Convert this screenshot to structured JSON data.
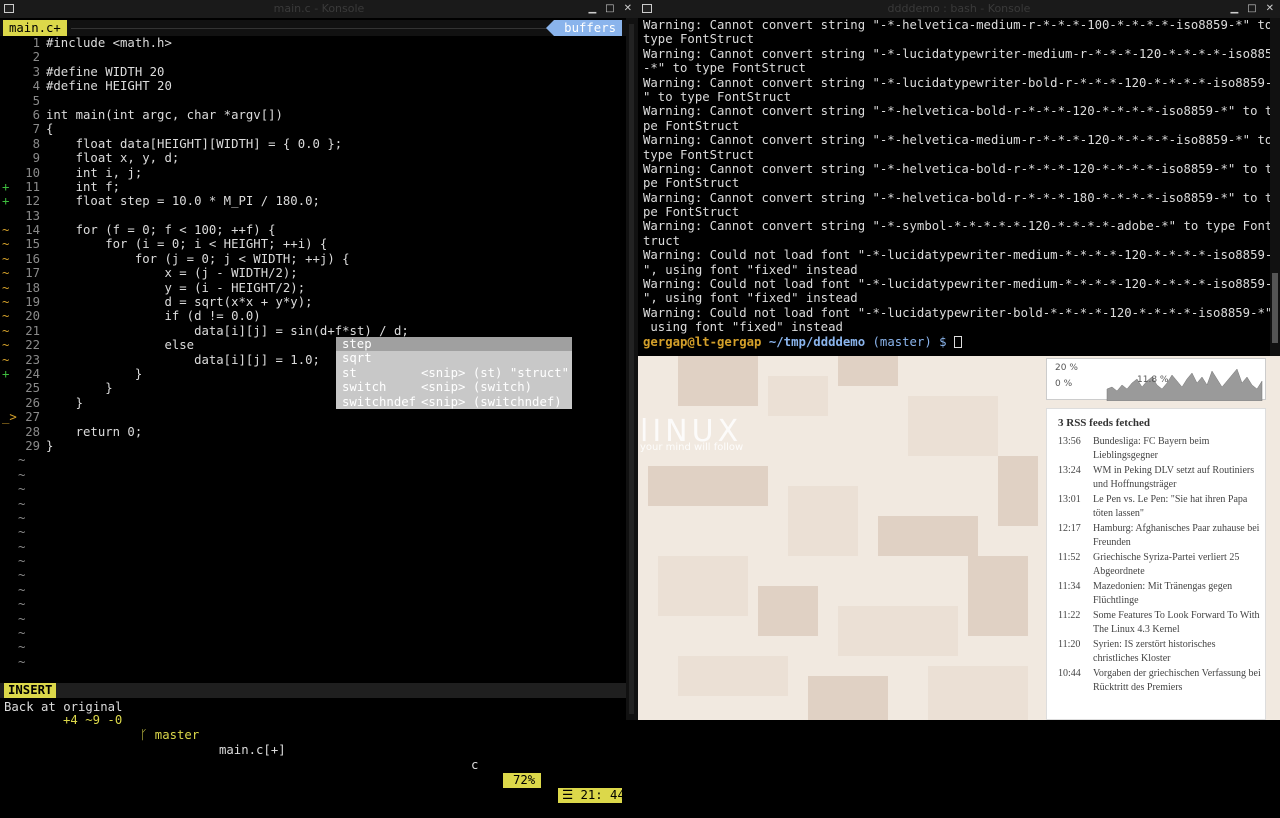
{
  "left_window": {
    "title": "main.c - Konsole"
  },
  "right_window": {
    "title": "ddddemo : bash - Konsole"
  },
  "vim": {
    "tab": "main.c+",
    "buffers_label": "buffers",
    "lines": [
      {
        "sign": "",
        "num": "1",
        "code": "#include <math.h>"
      },
      {
        "sign": "",
        "num": "2",
        "code": ""
      },
      {
        "sign": "",
        "num": "3",
        "code": "#define WIDTH 20"
      },
      {
        "sign": "",
        "num": "4",
        "code": "#define HEIGHT 20"
      },
      {
        "sign": "",
        "num": "5",
        "code": ""
      },
      {
        "sign": "",
        "num": "6",
        "code": "int main(int argc, char *argv[])"
      },
      {
        "sign": "",
        "num": "7",
        "code": "{"
      },
      {
        "sign": "",
        "num": "8",
        "code": "    float data[HEIGHT][WIDTH] = { 0.0 };"
      },
      {
        "sign": "",
        "num": "9",
        "code": "    float x, y, d;"
      },
      {
        "sign": "",
        "num": "10",
        "code": "    int i, j;"
      },
      {
        "sign": "+",
        "num": "11",
        "code": "    int f;"
      },
      {
        "sign": "+",
        "num": "12",
        "code": "    float step = 10.0 * M_PI / 180.0;"
      },
      {
        "sign": "",
        "num": "13",
        "code": ""
      },
      {
        "sign": "~",
        "num": "14",
        "code": "    for (f = 0; f < 100; ++f) {"
      },
      {
        "sign": "~",
        "num": "15",
        "code": "        for (i = 0; i < HEIGHT; ++i) {"
      },
      {
        "sign": "~",
        "num": "16",
        "code": "            for (j = 0; j < WIDTH; ++j) {"
      },
      {
        "sign": "~",
        "num": "17",
        "code": "                x = (j - WIDTH/2);"
      },
      {
        "sign": "~",
        "num": "18",
        "code": "                y = (i - HEIGHT/2);"
      },
      {
        "sign": "~",
        "num": "19",
        "code": "                d = sqrt(x*x + y*y);"
      },
      {
        "sign": "~",
        "num": "20",
        "code": "                if (d != 0.0)"
      },
      {
        "sign": "~",
        "num": "21",
        "code": "                    data[i][j] = sin(d+f*st) / d;"
      },
      {
        "sign": "~",
        "num": "22",
        "code": "                else"
      },
      {
        "sign": "~",
        "num": "23",
        "code": "                    data[i][j] = 1.0;"
      },
      {
        "sign": "+",
        "num": "24",
        "code": "            }"
      },
      {
        "sign": "",
        "num": "25",
        "code": "        }"
      },
      {
        "sign": "",
        "num": "26",
        "code": "    }"
      },
      {
        "sign": "_>",
        "num": "27",
        "code": ""
      },
      {
        "sign": "",
        "num": "28",
        "code": "    return 0;"
      },
      {
        "sign": "",
        "num": "29",
        "code": "}"
      }
    ],
    "tilde_count": 15,
    "popup": [
      {
        "word": "step",
        "info": ""
      },
      {
        "word": "sqrt",
        "info": ""
      },
      {
        "word": "st",
        "info": "<snip> (st) \"struct\""
      },
      {
        "word": "switch",
        "info": "<snip> (switch)"
      },
      {
        "word": "switchndef",
        "info": "<snip> (switchndef)"
      }
    ],
    "status": {
      "mode": "INSERT",
      "hunks": "+4 ~9 -0",
      "branch_icon": "ᚴ",
      "branch": "master",
      "file": "main.c[+]",
      "filetype": "c",
      "percent": "72%",
      "line_symbol": "☰",
      "position": "21: 44"
    },
    "cmdline": "Back at original"
  },
  "terminal": {
    "lines": [
      "Warning: Cannot convert string \"-*-helvetica-medium-r-*-*-*-100-*-*-*-*-iso8859-*\" to",
      "type FontStruct",
      "Warning: Cannot convert string \"-*-lucidatypewriter-medium-r-*-*-*-120-*-*-*-*-iso8859",
      "-*\" to type FontStruct",
      "Warning: Cannot convert string \"-*-lucidatypewriter-bold-r-*-*-*-120-*-*-*-*-iso8859-*",
      "\" to type FontStruct",
      "Warning: Cannot convert string \"-*-helvetica-bold-r-*-*-*-120-*-*-*-*-iso8859-*\" to ty",
      "pe FontStruct",
      "Warning: Cannot convert string \"-*-helvetica-medium-r-*-*-*-120-*-*-*-*-iso8859-*\" to",
      "type FontStruct",
      "Warning: Cannot convert string \"-*-helvetica-bold-r-*-*-*-120-*-*-*-*-iso8859-*\" to ty",
      "pe FontStruct",
      "Warning: Cannot convert string \"-*-helvetica-bold-r-*-*-*-180-*-*-*-*-iso8859-*\" to ty",
      "pe FontStruct",
      "Warning: Cannot convert string \"-*-symbol-*-*-*-*-*-120-*-*-*-*-adobe-*\" to type FontS",
      "truct",
      "Warning: Could not load font \"-*-lucidatypewriter-medium-*-*-*-*-120-*-*-*-*-iso8859-*",
      "\", using font \"fixed\" instead",
      "Warning: Could not load font \"-*-lucidatypewriter-medium-*-*-*-*-120-*-*-*-*-iso8859-*",
      "\", using font \"fixed\" instead",
      "Warning: Could not load font \"-*-lucidatypewriter-bold-*-*-*-*-120-*-*-*-*-iso8859-*\",",
      " using font \"fixed\" instead"
    ],
    "prompt": {
      "user": "gergap@lt-gergap",
      "path": "~/tmp/ddddemo",
      "branch": "(master) $"
    }
  },
  "desktop": {
    "logo_text": "lINUX",
    "tagline": "your mind will follow",
    "cpu_graph": {
      "top_label": "20 %",
      "bottom_label": "0 %",
      "mid_label": "11.8 %"
    },
    "rss": {
      "title": "3 RSS feeds fetched",
      "items": [
        {
          "time": "13:56",
          "text": "Bundesliga: FC Bayern beim Lieblingsgegner"
        },
        {
          "time": "13:24",
          "text": "WM in Peking DLV setzt auf Routiniers und Hoffnungsträger"
        },
        {
          "time": "13:01",
          "text": "Le Pen vs. Le Pen: \"Sie hat ihren Papa töten lassen\""
        },
        {
          "time": "12:17",
          "text": "Hamburg: Afghanisches Paar zuhause bei Freunden"
        },
        {
          "time": "11:52",
          "text": "Griechische Syriza-Partei verliert 25 Abgeordnete"
        },
        {
          "time": "11:34",
          "text": "Mazedonien: Mit Tränengas gegen Flüchtlinge"
        },
        {
          "time": "11:22",
          "text": "Some Features To Look Forward To With The Linux 4.3 Kernel"
        },
        {
          "time": "11:20",
          "text": "Syrien: IS zerstört historisches christliches Kloster"
        },
        {
          "time": "10:44",
          "text": "Vorgaben der griechischen Verfassung bei Rücktritt des Premiers"
        }
      ]
    }
  }
}
